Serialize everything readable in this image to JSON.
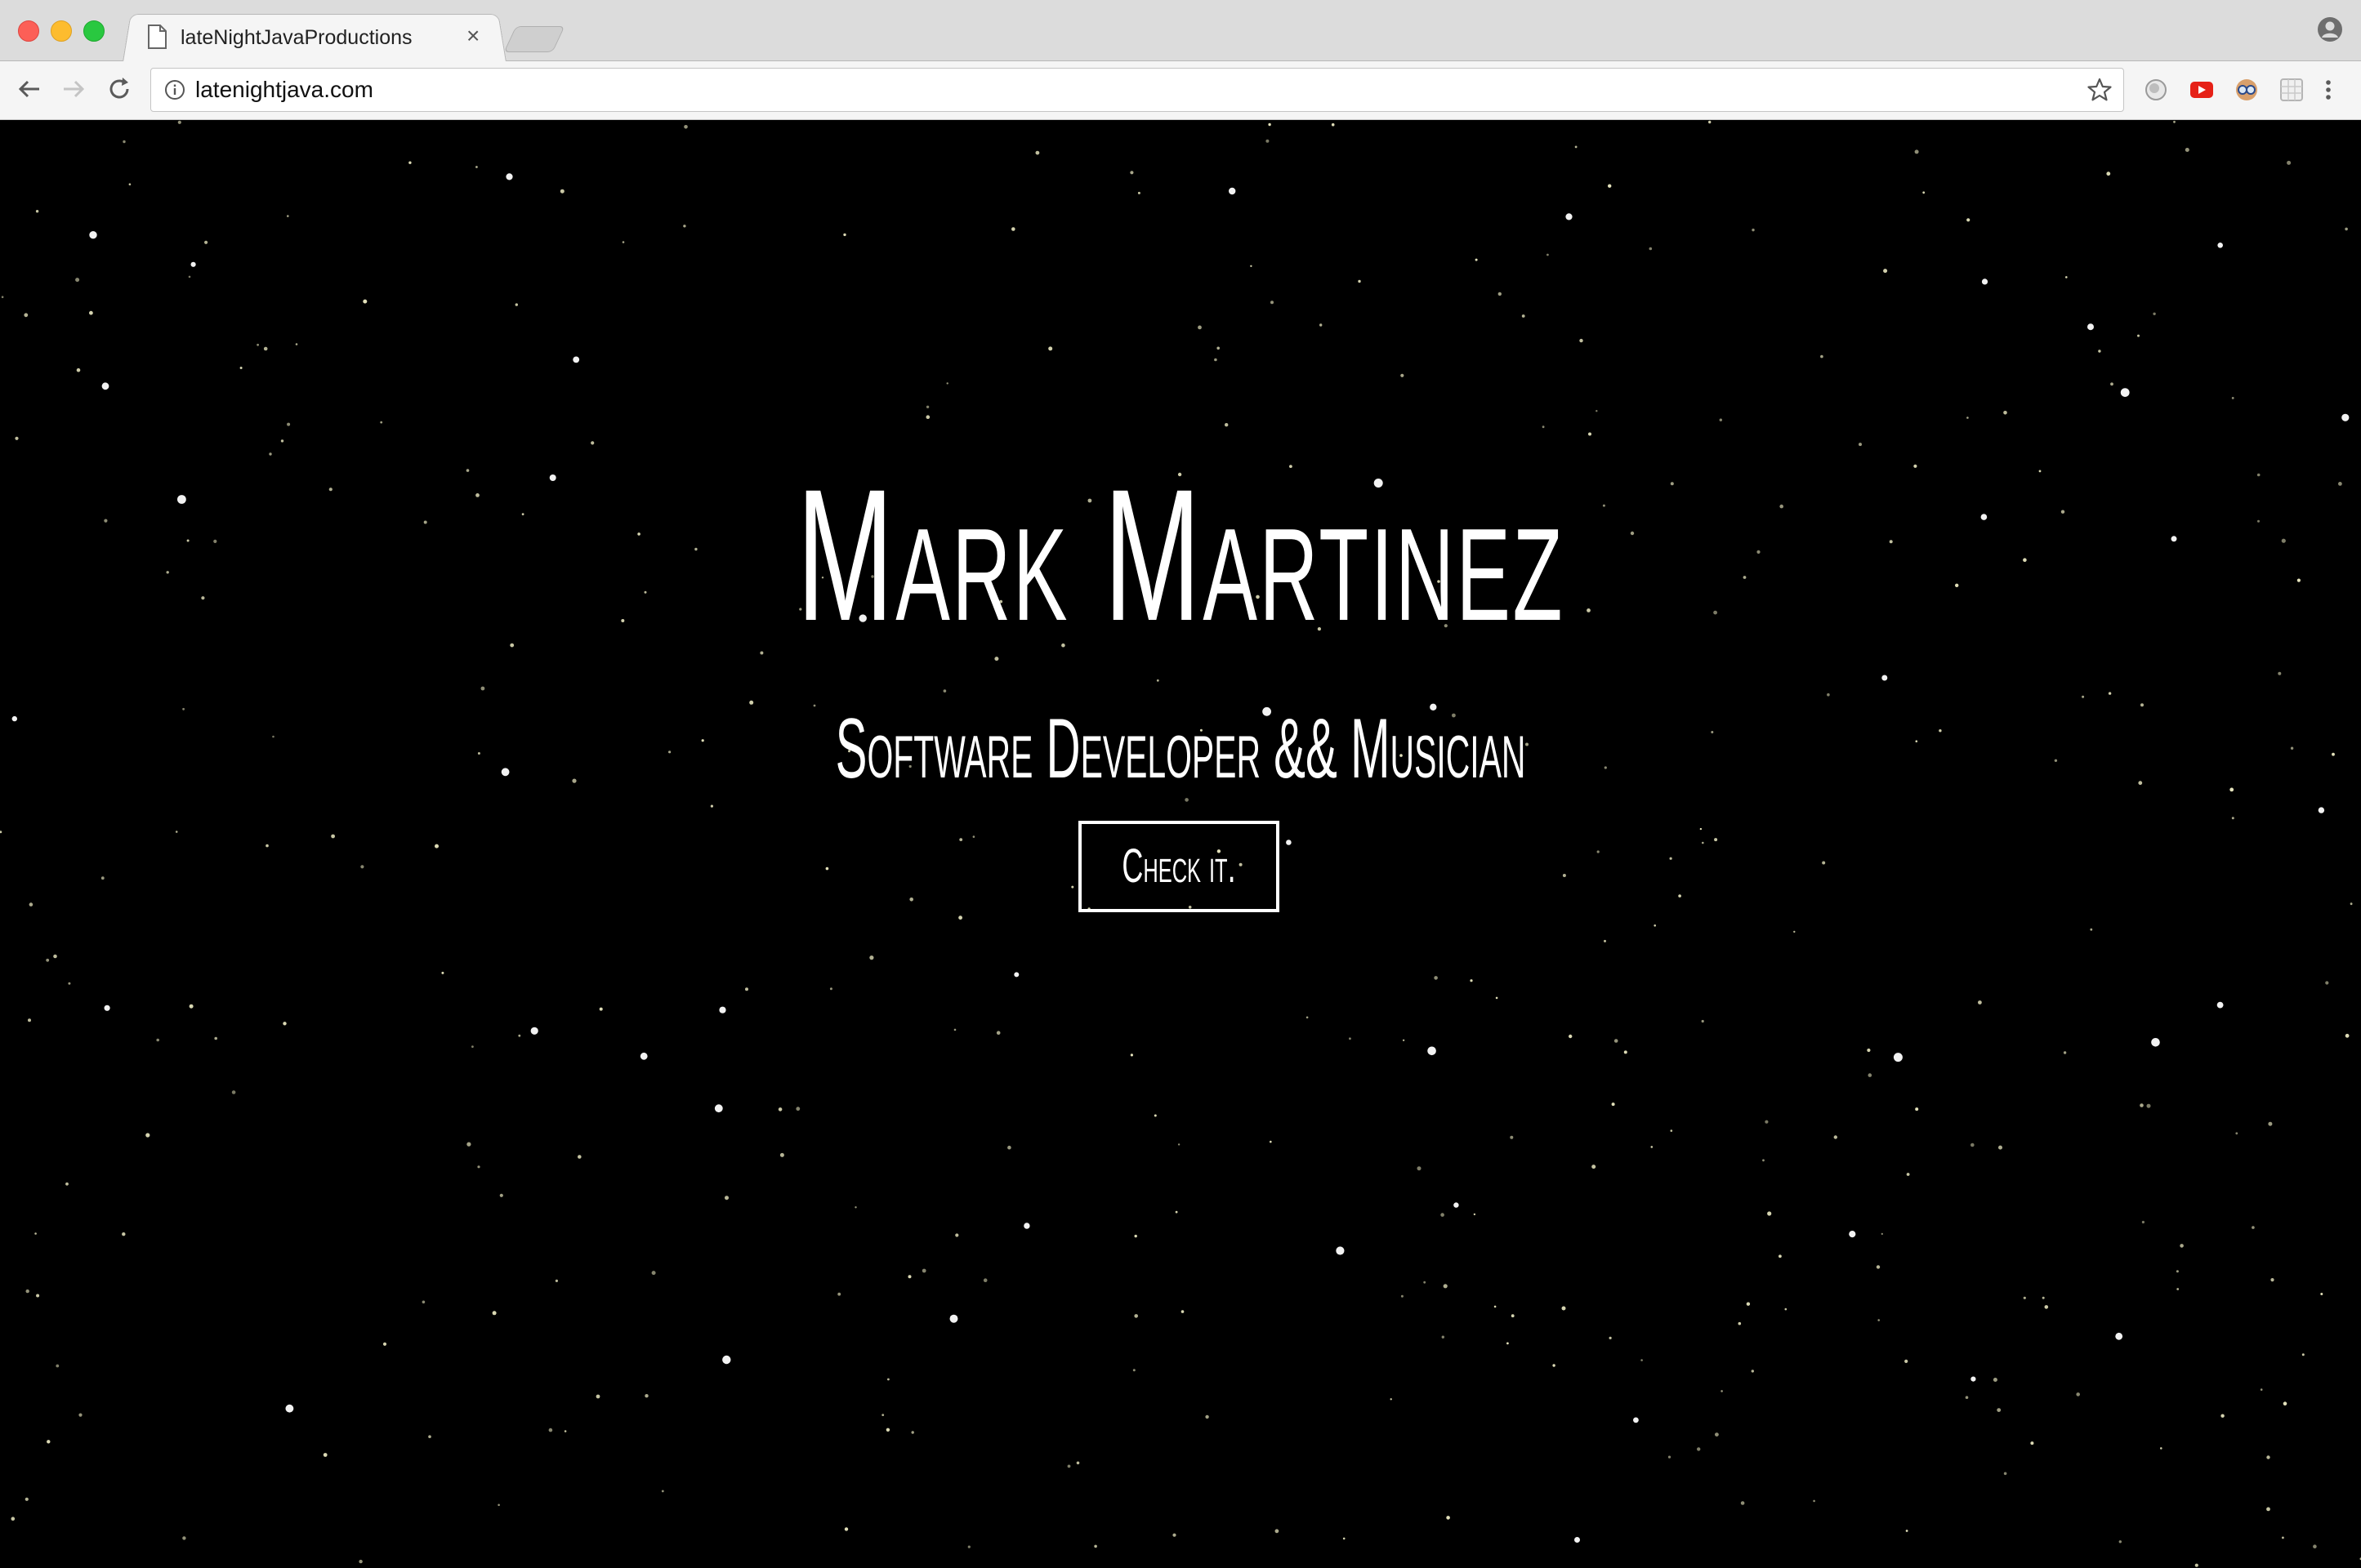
{
  "browser": {
    "tab_title": "lateNightJavaProductions",
    "tab_close": "×",
    "url": "latenightjava.com"
  },
  "icons": {
    "back": "back-arrow-icon",
    "forward": "forward-arrow-icon",
    "reload": "reload-icon",
    "info": "info-icon",
    "bookmark": "star-icon",
    "extensions": [
      "circle-extension-icon",
      "youtube-extension-icon",
      "glasses-extension-icon",
      "grid-extension-icon"
    ],
    "menu": "kebab-menu-icon",
    "profile": "profile-icon"
  },
  "hero": {
    "name": "Mark Martinez",
    "subtitle": "Software Developer && Musician",
    "cta": "Check it."
  },
  "colors": {
    "background": "#000000",
    "text": "#ffffff",
    "star": "#f3f1c8"
  }
}
